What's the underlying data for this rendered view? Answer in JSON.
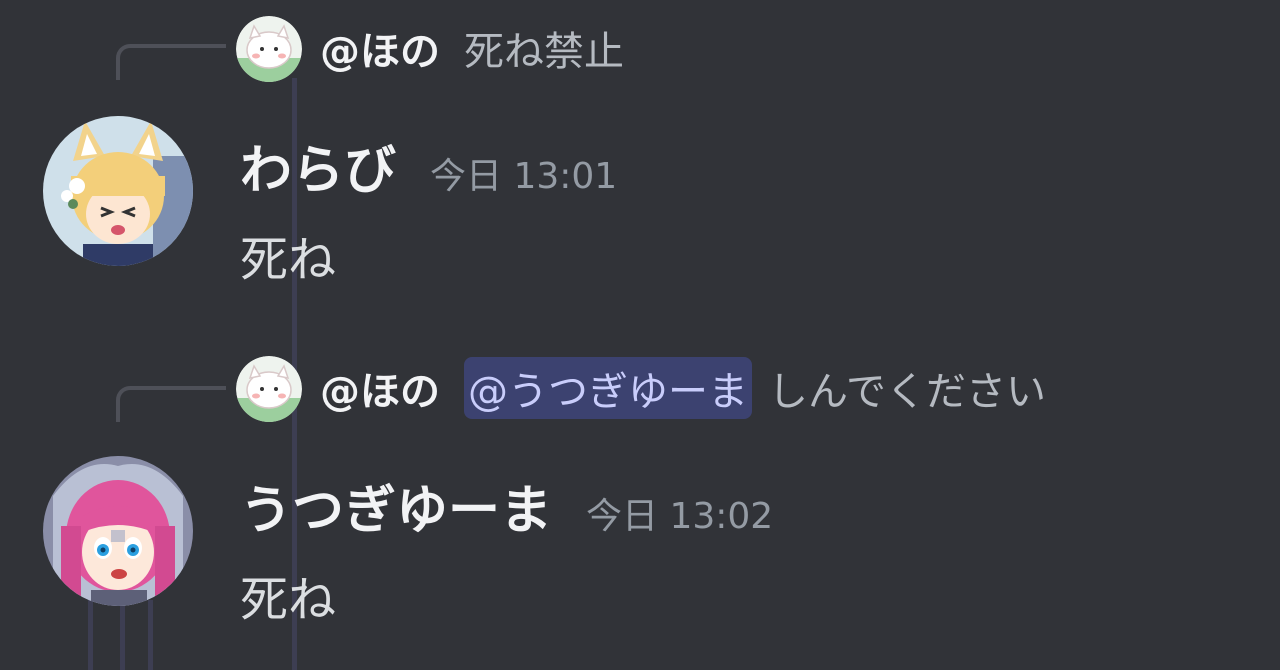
{
  "messages": [
    {
      "reply": {
        "author": "@ほの",
        "text": "死ね禁止",
        "mention": ""
      },
      "author": "わらび",
      "timestamp": "今日 13:01",
      "content": "死ね"
    },
    {
      "reply": {
        "author": "@ほの",
        "mention": "@うつぎゆーま",
        "text": "しんでください"
      },
      "author": "うつぎゆーま",
      "timestamp": "今日 13:02",
      "content": "死ね"
    }
  ],
  "colors": {
    "background": "#313338",
    "mention_bg": "#3c4270",
    "mention_text": "#c9cdfb",
    "username": "#f2f3f5",
    "timestamp": "#949ba4",
    "content": "#dbdee1"
  },
  "icons": {
    "reply_avatar": "white-cat-avatar",
    "avatar_1": "blonde-fox-girl-avatar",
    "avatar_2": "pink-hair-girl-avatar"
  }
}
